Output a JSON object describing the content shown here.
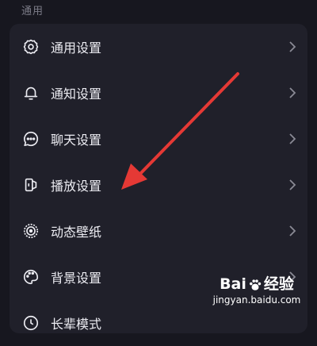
{
  "section": {
    "title": "通用"
  },
  "items": [
    {
      "label": "通用设置",
      "icon": "gear-icon"
    },
    {
      "label": "通知设置",
      "icon": "bell-icon"
    },
    {
      "label": "聊天设置",
      "icon": "chat-bubble-icon"
    },
    {
      "label": "播放设置",
      "icon": "player-icon"
    },
    {
      "label": "动态壁纸",
      "icon": "live-wallpaper-icon"
    },
    {
      "label": "背景设置",
      "icon": "palette-icon"
    },
    {
      "label": "长辈模式",
      "icon": "elder-mode-icon"
    }
  ],
  "watermark": {
    "brand_left": "Bai",
    "brand_right": "经验",
    "url": "jingyan.baidu.com"
  },
  "colors": {
    "background": "#17171f",
    "card": "#20202a",
    "text": "#ececf2",
    "arrow": "#e53935",
    "chevron": "#8a8a95"
  }
}
